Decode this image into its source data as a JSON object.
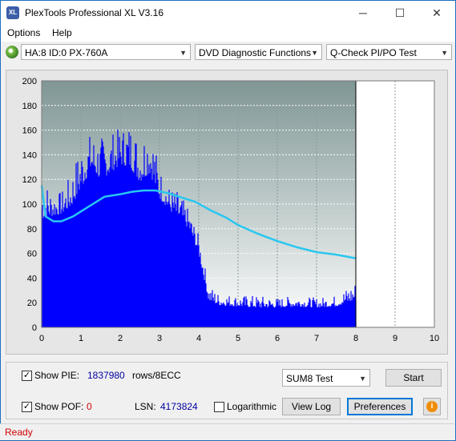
{
  "window": {
    "title": "PlexTools Professional XL V3.16",
    "logo_text": "XL",
    "min": "─",
    "max": "☐",
    "close": "✕"
  },
  "menu": {
    "options": "Options",
    "help": "Help"
  },
  "toolbar": {
    "drive": "HA:8 ID:0  PX-760A",
    "function": "DVD Diagnostic Functions",
    "test": "Q-Check PI/PO Test"
  },
  "chart_data": {
    "type": "bar",
    "title": "",
    "xlabel": "",
    "ylabel": "",
    "xlim": [
      0,
      10
    ],
    "ylim": [
      0,
      200
    ],
    "x_ticks": [
      "0",
      "1",
      "2",
      "3",
      "4",
      "5",
      "6",
      "7",
      "8",
      "9",
      "10"
    ],
    "y_ticks": [
      "0",
      "20",
      "40",
      "60",
      "80",
      "100",
      "120",
      "140",
      "160",
      "180",
      "200"
    ],
    "grid": true,
    "data_end_x": 8,
    "series": [
      {
        "kind": "bars",
        "color": "#0000ff",
        "x": [
          0,
          0.25,
          0.5,
          0.75,
          1,
          1.25,
          1.5,
          1.75,
          2,
          2.25,
          2.5,
          2.75,
          3,
          3.25,
          3.5,
          3.75,
          4,
          4.25,
          4.5,
          5,
          5.5,
          6,
          6.5,
          7,
          7.5,
          8
        ],
        "peak": [
          125,
          112,
          110,
          125,
          150,
          158,
          155,
          158,
          162,
          168,
          155,
          172,
          130,
          115,
          110,
          95,
          75,
          35,
          28,
          26,
          26,
          24,
          26,
          24,
          26,
          38
        ],
        "base": [
          88,
          90,
          92,
          98,
          112,
          128,
          120,
          125,
          132,
          130,
          118,
          125,
          105,
          95,
          88,
          80,
          60,
          22,
          18,
          17,
          16,
          16,
          17,
          16,
          17,
          22
        ]
      },
      {
        "kind": "line",
        "color": "#29c7f0",
        "x": [
          0,
          0.1,
          0.3,
          0.5,
          0.8,
          1,
          1.3,
          1.6,
          2,
          2.3,
          2.6,
          2.9,
          3.2,
          3.5,
          3.9,
          4.3,
          4.7,
          5,
          5.5,
          6,
          6.5,
          7,
          7.5,
          8
        ],
        "y": [
          115,
          90,
          86,
          86,
          90,
          94,
          100,
          106,
          108,
          110,
          111,
          111,
          109,
          106,
          102,
          95,
          89,
          83,
          76,
          70,
          65,
          61,
          59,
          56
        ]
      }
    ]
  },
  "panel": {
    "show_pie": "Show PIE:",
    "pie_value": "1837980",
    "pie_unit": "rows/8ECC",
    "show_pof": "Show POF:",
    "pof_value": "0",
    "lsn_label": "LSN:",
    "lsn_value": "4173824",
    "logarithmic": "Logarithmic",
    "sum_select": "SUM8 Test",
    "start": "Start",
    "view_log": "View Log",
    "preferences": "Preferences"
  },
  "status": {
    "text": "Ready"
  }
}
